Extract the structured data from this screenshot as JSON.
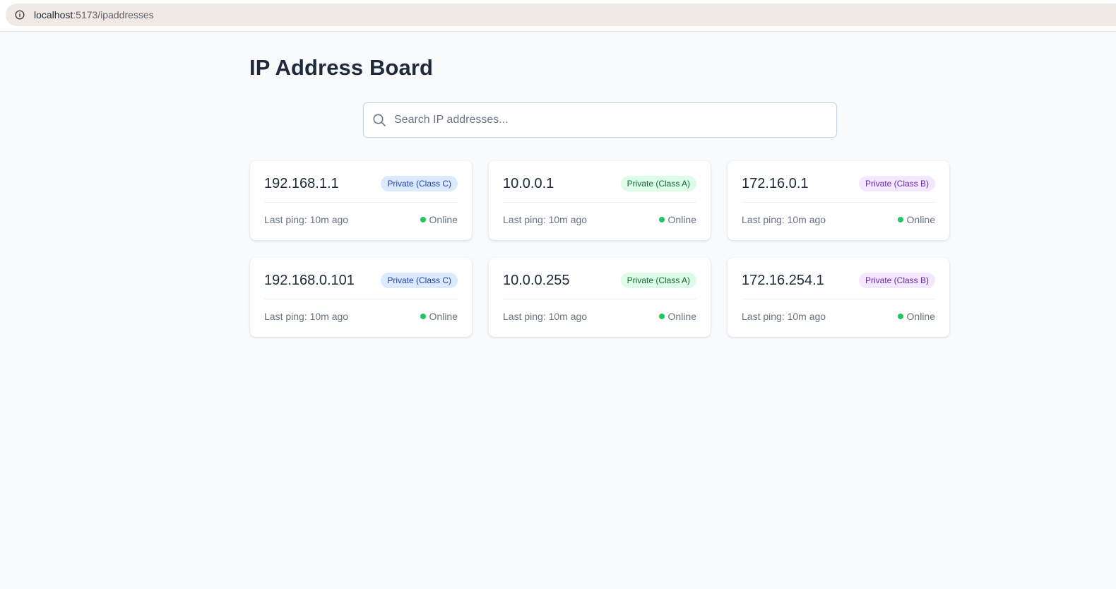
{
  "browser": {
    "url_host": "localhost",
    "url_path": ":5173/ipaddresses"
  },
  "page": {
    "title": "IP Address Board"
  },
  "search": {
    "placeholder": "Search IP addresses...",
    "value": ""
  },
  "cards": [
    {
      "ip": "192.168.1.1",
      "badge": "Private (Class C)",
      "badge_class": "c",
      "last_ping": "Last ping: 10m ago",
      "status": "Online"
    },
    {
      "ip": "10.0.0.1",
      "badge": "Private (Class A)",
      "badge_class": "a",
      "last_ping": "Last ping: 10m ago",
      "status": "Online"
    },
    {
      "ip": "172.16.0.1",
      "badge": "Private (Class B)",
      "badge_class": "b",
      "last_ping": "Last ping: 10m ago",
      "status": "Online"
    },
    {
      "ip": "192.168.0.101",
      "badge": "Private (Class C)",
      "badge_class": "c",
      "last_ping": "Last ping: 10m ago",
      "status": "Online"
    },
    {
      "ip": "10.0.0.255",
      "badge": "Private (Class A)",
      "badge_class": "a",
      "last_ping": "Last ping: 10m ago",
      "status": "Online"
    },
    {
      "ip": "172.16.254.1",
      "badge": "Private (Class B)",
      "badge_class": "b",
      "last_ping": "Last ping: 10m ago",
      "status": "Online"
    }
  ],
  "colors": {
    "online": "#22c55e",
    "class_c_bg": "#dbeafe",
    "class_a_bg": "#dcfce7",
    "class_b_bg": "#f3e8ff"
  }
}
